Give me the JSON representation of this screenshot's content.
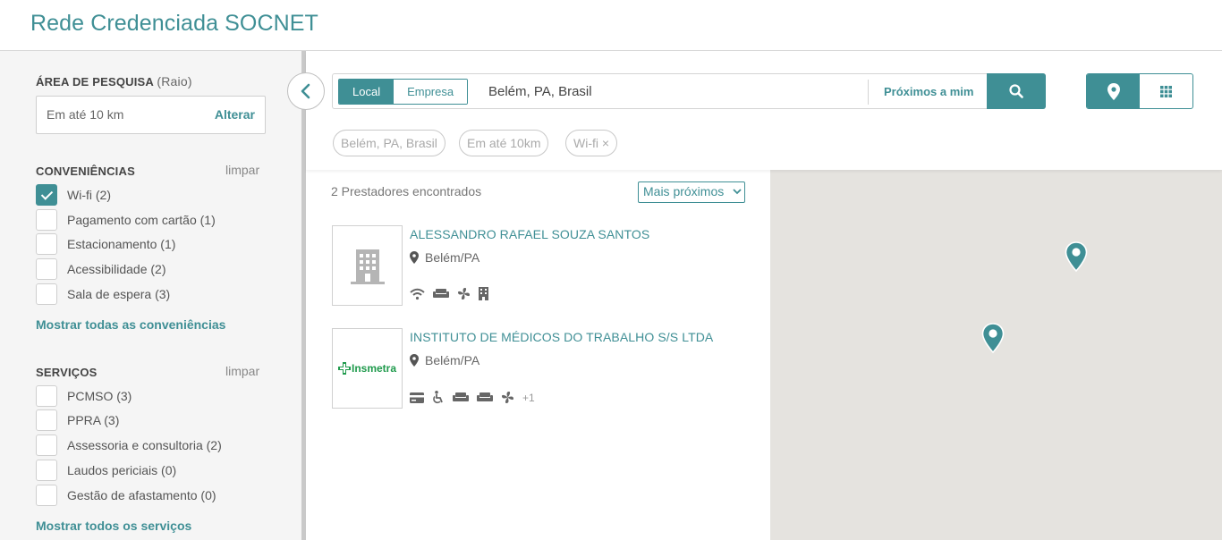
{
  "header": {
    "title": "Rede Credenciada SOCNET"
  },
  "sidebar": {
    "area": {
      "title": "ÁREA DE PESQUISA",
      "subtitle": "(Raio)",
      "value": "Em até 10 km",
      "change_label": "Alterar"
    },
    "conveniences": {
      "title": "CONVENIÊNCIAS",
      "clear_label": "limpar",
      "items": [
        {
          "label": "Wi-fi  (2)",
          "checked": true
        },
        {
          "label": "Pagamento com cartão  (1)",
          "checked": false
        },
        {
          "label": "Estacionamento  (1)",
          "checked": false
        },
        {
          "label": "Acessibilidade  (2)",
          "checked": false
        },
        {
          "label": "Sala de espera  (3)",
          "checked": false
        }
      ],
      "show_all_label": "Mostrar todas as conveniências"
    },
    "services": {
      "title": "SERVIÇOS",
      "clear_label": "limpar",
      "items": [
        {
          "label": "PCMSO  (3)",
          "checked": false
        },
        {
          "label": "PPRA  (3)",
          "checked": false
        },
        {
          "label": "Assessoria e consultoria  (2)",
          "checked": false
        },
        {
          "label": "Laudos periciais  (0)",
          "checked": false
        },
        {
          "label": "Gestão de afastamento  (0)",
          "checked": false
        }
      ],
      "show_all_label": "Mostrar todos os serviços"
    }
  },
  "search": {
    "tabs": [
      "Local",
      "Empresa"
    ],
    "active_tab": "Local",
    "location_value": "Belém, PA, Brasil",
    "near_me_label": "Próximos a mim"
  },
  "filters": {
    "chips": [
      "Belém, PA, Brasil",
      "Em até 10km",
      "Wi-fi ×"
    ]
  },
  "results": {
    "count_label": "2 Prestadores encontrados",
    "sort_value": "Mais próximos",
    "items": [
      {
        "name": "ALESSANDRO RAFAEL SOUZA SANTOS",
        "city": "Belém/PA",
        "logo": "building-placeholder-icon",
        "amenities": [
          "wifi-icon",
          "sofa-icon",
          "fan-icon",
          "building-icon"
        ]
      },
      {
        "name": "INSTITUTO DE MÉDICOS DO TRABALHO S/S LTDA",
        "city": "Belém/PA",
        "logo_text": "Insmetra",
        "amenities": [
          "credit-card-icon",
          "wheelchair-icon",
          "sofa-icon",
          "sofa-icon",
          "fan-icon"
        ],
        "more": "+1"
      }
    ]
  },
  "colors": {
    "accent": "#3f8f95",
    "map": "#e5e3df",
    "sidebar": "#f5f5f5",
    "logo_green": "#1f9a4c"
  }
}
